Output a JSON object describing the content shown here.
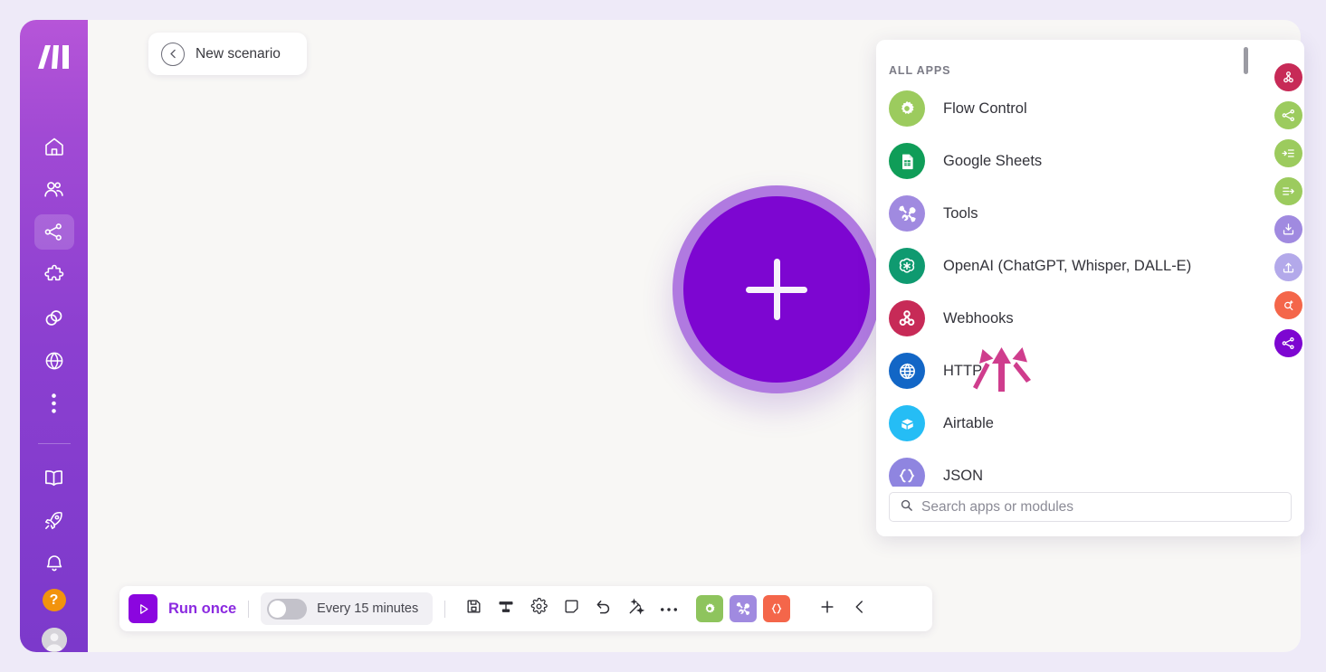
{
  "app": {
    "name": "Make",
    "logo_icon": "make-logo-icon"
  },
  "colors": {
    "sidebar_top": "#b655d8",
    "sidebar_bottom": "#7c39cb",
    "accent_purple": "#8b06df",
    "add_button": "#7d06d1",
    "add_halo": "#b07ae0",
    "annotation_pink": "#cf3d8d",
    "help_orange": "#f2930d",
    "canvas": "#f8f7f5",
    "page_background": "#eeeaf8"
  },
  "scenario": {
    "back_icon": "arrow-left-circle-icon",
    "title": "New scenario"
  },
  "canvas": {
    "add_module_label": "+",
    "add_module_icon": "plus-icon"
  },
  "sidebar": {
    "items": [
      {
        "icon": "home-icon",
        "name": "home",
        "active": false
      },
      {
        "icon": "team-icon",
        "name": "team",
        "active": false
      },
      {
        "icon": "scenarios-icon",
        "name": "scenarios",
        "active": true
      },
      {
        "icon": "templates-puzzle-icon",
        "name": "templates",
        "active": false
      },
      {
        "icon": "connections-link-icon",
        "name": "connections",
        "active": false
      },
      {
        "icon": "webhooks-globe-icon",
        "name": "webhooks",
        "active": false
      },
      {
        "icon": "more-dots-icon",
        "name": "more",
        "active": false
      }
    ],
    "secondary_items": [
      {
        "icon": "book-icon",
        "name": "docs"
      },
      {
        "icon": "rocket-icon",
        "name": "whats-new"
      },
      {
        "icon": "bell-icon",
        "name": "notifications"
      }
    ],
    "help_label": "?",
    "help_icon": "help-question-icon",
    "avatar_icon": "user-avatar-icon"
  },
  "apps_panel": {
    "header": "ALL APPS",
    "apps": [
      {
        "label": "Flow Control",
        "icon": "flow-control-icon",
        "color": "#9ccb5e",
        "glyph": "gear"
      },
      {
        "label": "Google Sheets",
        "icon": "google-sheets-icon",
        "color": "#0f9d58",
        "glyph": "sheet"
      },
      {
        "label": "Tools",
        "icon": "tools-icon",
        "color": "#a08ae0",
        "glyph": "tools"
      },
      {
        "label": "OpenAI (ChatGPT, Whisper, DALL-E)",
        "icon": "openai-icon",
        "color": "#0f9a70",
        "glyph": "openai"
      },
      {
        "label": "Webhooks",
        "icon": "webhooks-icon",
        "color": "#c72a57",
        "glyph": "webhook"
      },
      {
        "label": "HTTP",
        "icon": "http-icon",
        "color": "#1266c6",
        "glyph": "globe"
      },
      {
        "label": "Airtable",
        "icon": "airtable-icon",
        "color": "#25bdf5",
        "glyph": "airtable"
      },
      {
        "label": "JSON",
        "icon": "json-icon",
        "color": "#8f85e0",
        "glyph": "json"
      }
    ],
    "search": {
      "placeholder": "Search apps or modules",
      "value": "",
      "icon": "search-icon"
    },
    "scrollbar": "panel-scrollbar"
  },
  "icon_rail": [
    {
      "name": "webhooks-rail-icon",
      "color": "#c72a57",
      "glyph": "webhook"
    },
    {
      "name": "router-rail-icon",
      "color": "#9ccb5e",
      "glyph": "router"
    },
    {
      "name": "aggregator-rail-icon",
      "color": "#9ccb5e",
      "glyph": "aggregator"
    },
    {
      "name": "iterator-rail-icon",
      "color": "#9ccb5e",
      "glyph": "iterator"
    },
    {
      "name": "download-rail-icon",
      "color": "#a08ae0",
      "glyph": "download"
    },
    {
      "name": "upload-rail-icon",
      "color": "#b3a9ea",
      "glyph": "upload"
    },
    {
      "name": "search-rail-icon",
      "color": "#f4664a",
      "glyph": "search-plus"
    },
    {
      "name": "share-rail-icon",
      "color": "#7d06d1",
      "glyph": "share"
    }
  ],
  "annotation": {
    "name": "pink-arrows-pointing-at-webhooks",
    "arrow_count": 3,
    "target": "Webhooks"
  },
  "toolbar": {
    "run_label": "Run once",
    "run_icon": "play-icon",
    "schedule_label": "Every 15 minutes",
    "schedule_enabled": false,
    "buttons": [
      {
        "name": "save-button",
        "icon": "save-disk-icon"
      },
      {
        "name": "align-button",
        "icon": "align-icon"
      },
      {
        "name": "settings-button",
        "icon": "gear-icon"
      },
      {
        "name": "notes-button",
        "icon": "note-icon"
      },
      {
        "name": "undo-button",
        "icon": "undo-icon"
      },
      {
        "name": "auto-align-button",
        "icon": "magic-wand-icon"
      },
      {
        "name": "more-button",
        "icon": "ellipsis-icon"
      }
    ],
    "color_buttons": [
      {
        "name": "flow-control-shortcut",
        "color": "#8ec45d",
        "glyph": "gear"
      },
      {
        "name": "tools-shortcut",
        "color": "#a08ae0",
        "glyph": "tools"
      },
      {
        "name": "json-shortcut",
        "color": "#f4664a",
        "glyph": "json"
      }
    ],
    "add_button": {
      "name": "add-module-button",
      "icon": "plus-icon"
    },
    "collapse_button": {
      "name": "collapse-panel-button",
      "icon": "chevron-left-icon"
    }
  }
}
